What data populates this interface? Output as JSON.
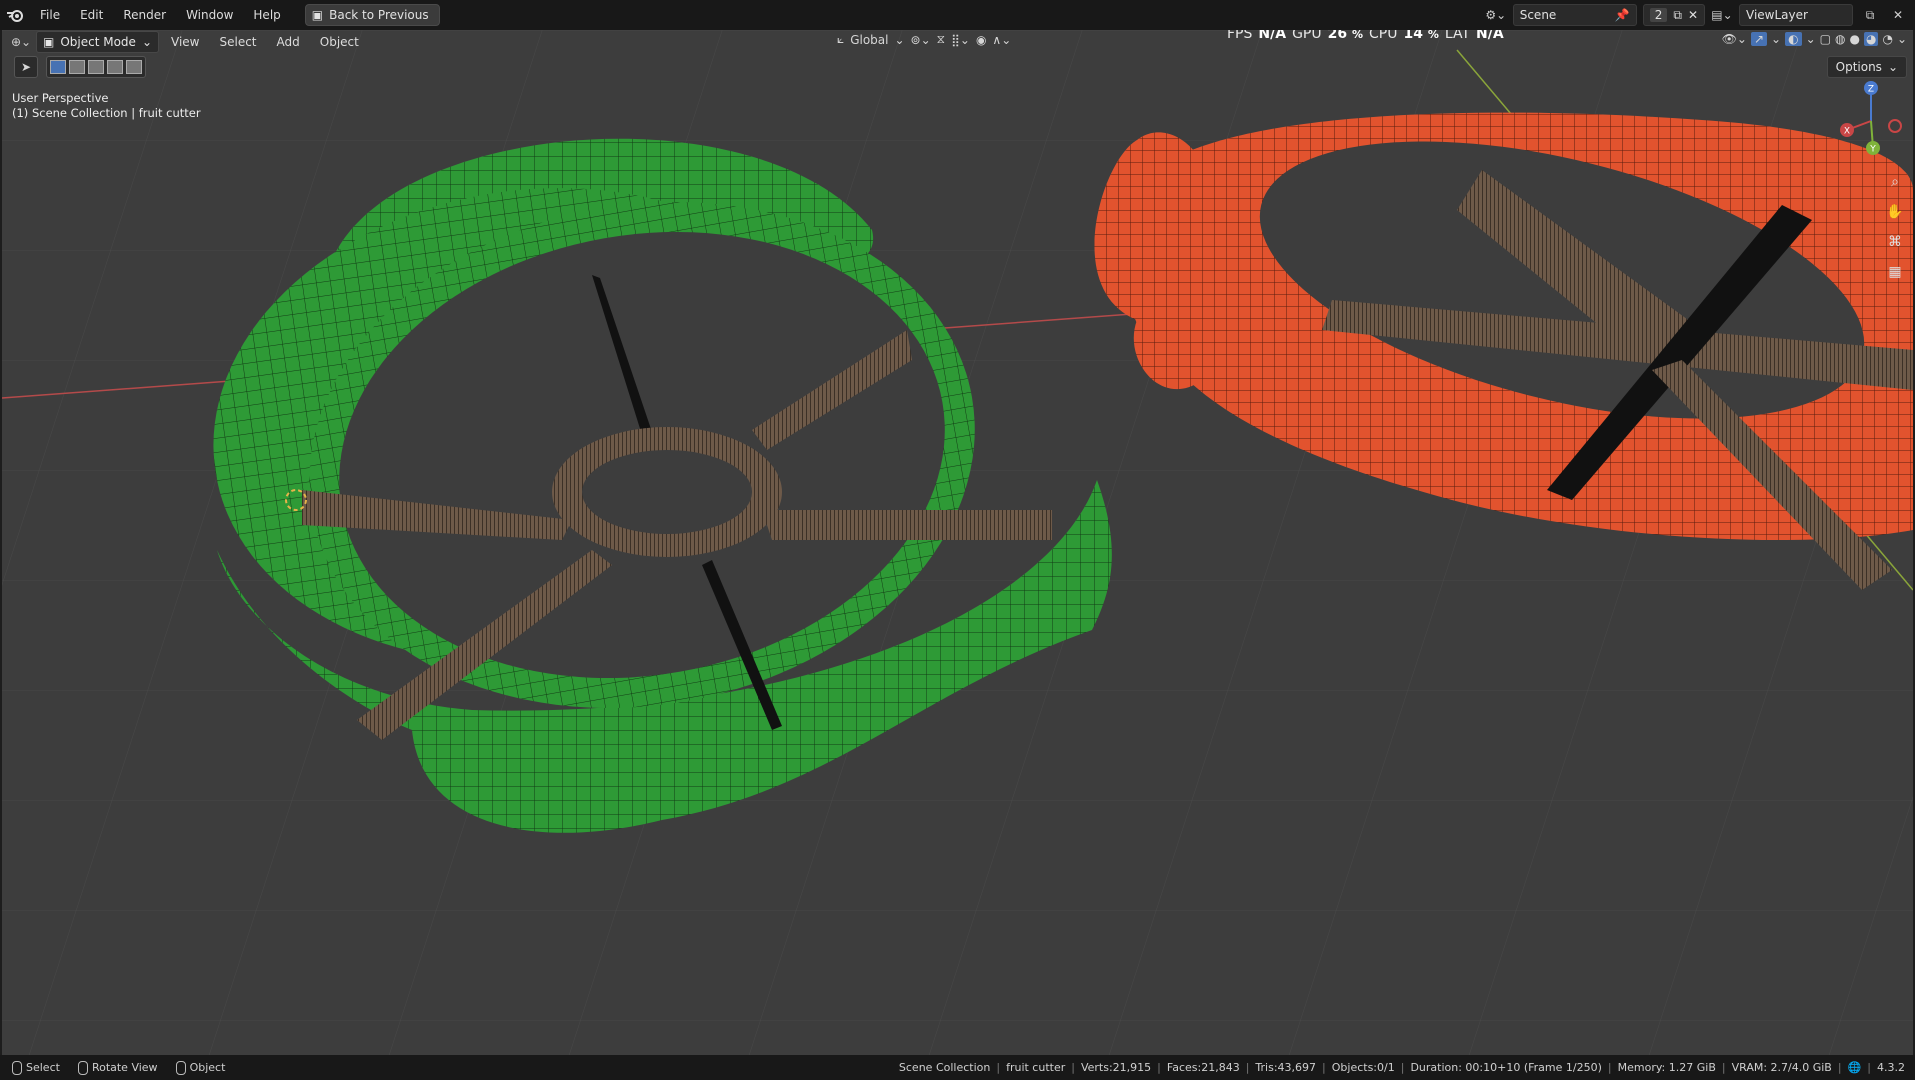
{
  "topbar": {
    "menu": [
      "File",
      "Edit",
      "Render",
      "Window",
      "Help"
    ],
    "back_button": "Back to Previous",
    "scene_name": "Scene",
    "scene_users": "2",
    "view_layer": "ViewLayer"
  },
  "header": {
    "mode": "Object Mode",
    "menus": [
      "View",
      "Select",
      "Add",
      "Object"
    ],
    "transform_orientation": "Global",
    "options_label": "Options"
  },
  "stats": {
    "fps_label": "FPS",
    "fps_value": "N/A",
    "gpu_label": "GPU",
    "gpu_value": "26",
    "gpu_unit": "%",
    "cpu_label": "CPU",
    "cpu_value": "14",
    "cpu_unit": "%",
    "lat_label": "LAT",
    "lat_value": "N/A"
  },
  "viewport": {
    "perspective": "User Perspective",
    "collection": "(1) Scene Collection | fruit cutter"
  },
  "gizmo": {
    "x": "X",
    "y": "Y",
    "z": "Z"
  },
  "statusbar": {
    "select": "Select",
    "rotate": "Rotate View",
    "object": "Object",
    "collection": "Scene Collection",
    "object_name": "fruit cutter",
    "verts": "Verts:21,915",
    "faces": "Faces:21,843",
    "tris": "Tris:43,697",
    "objects": "Objects:0/1",
    "duration": "Duration: 00:10+10 (Frame 1/250)",
    "memory": "Memory: 1.27 GiB",
    "vram": "VRAM: 2.7/4.0 GiB",
    "version": "4.3.2"
  },
  "colors": {
    "green_object": "#2e9a36",
    "orange_object": "#e2532e",
    "viewport_bg": "#3d3d3d",
    "x_axis": "#b44a4a",
    "y_axis": "#8aa53a"
  }
}
